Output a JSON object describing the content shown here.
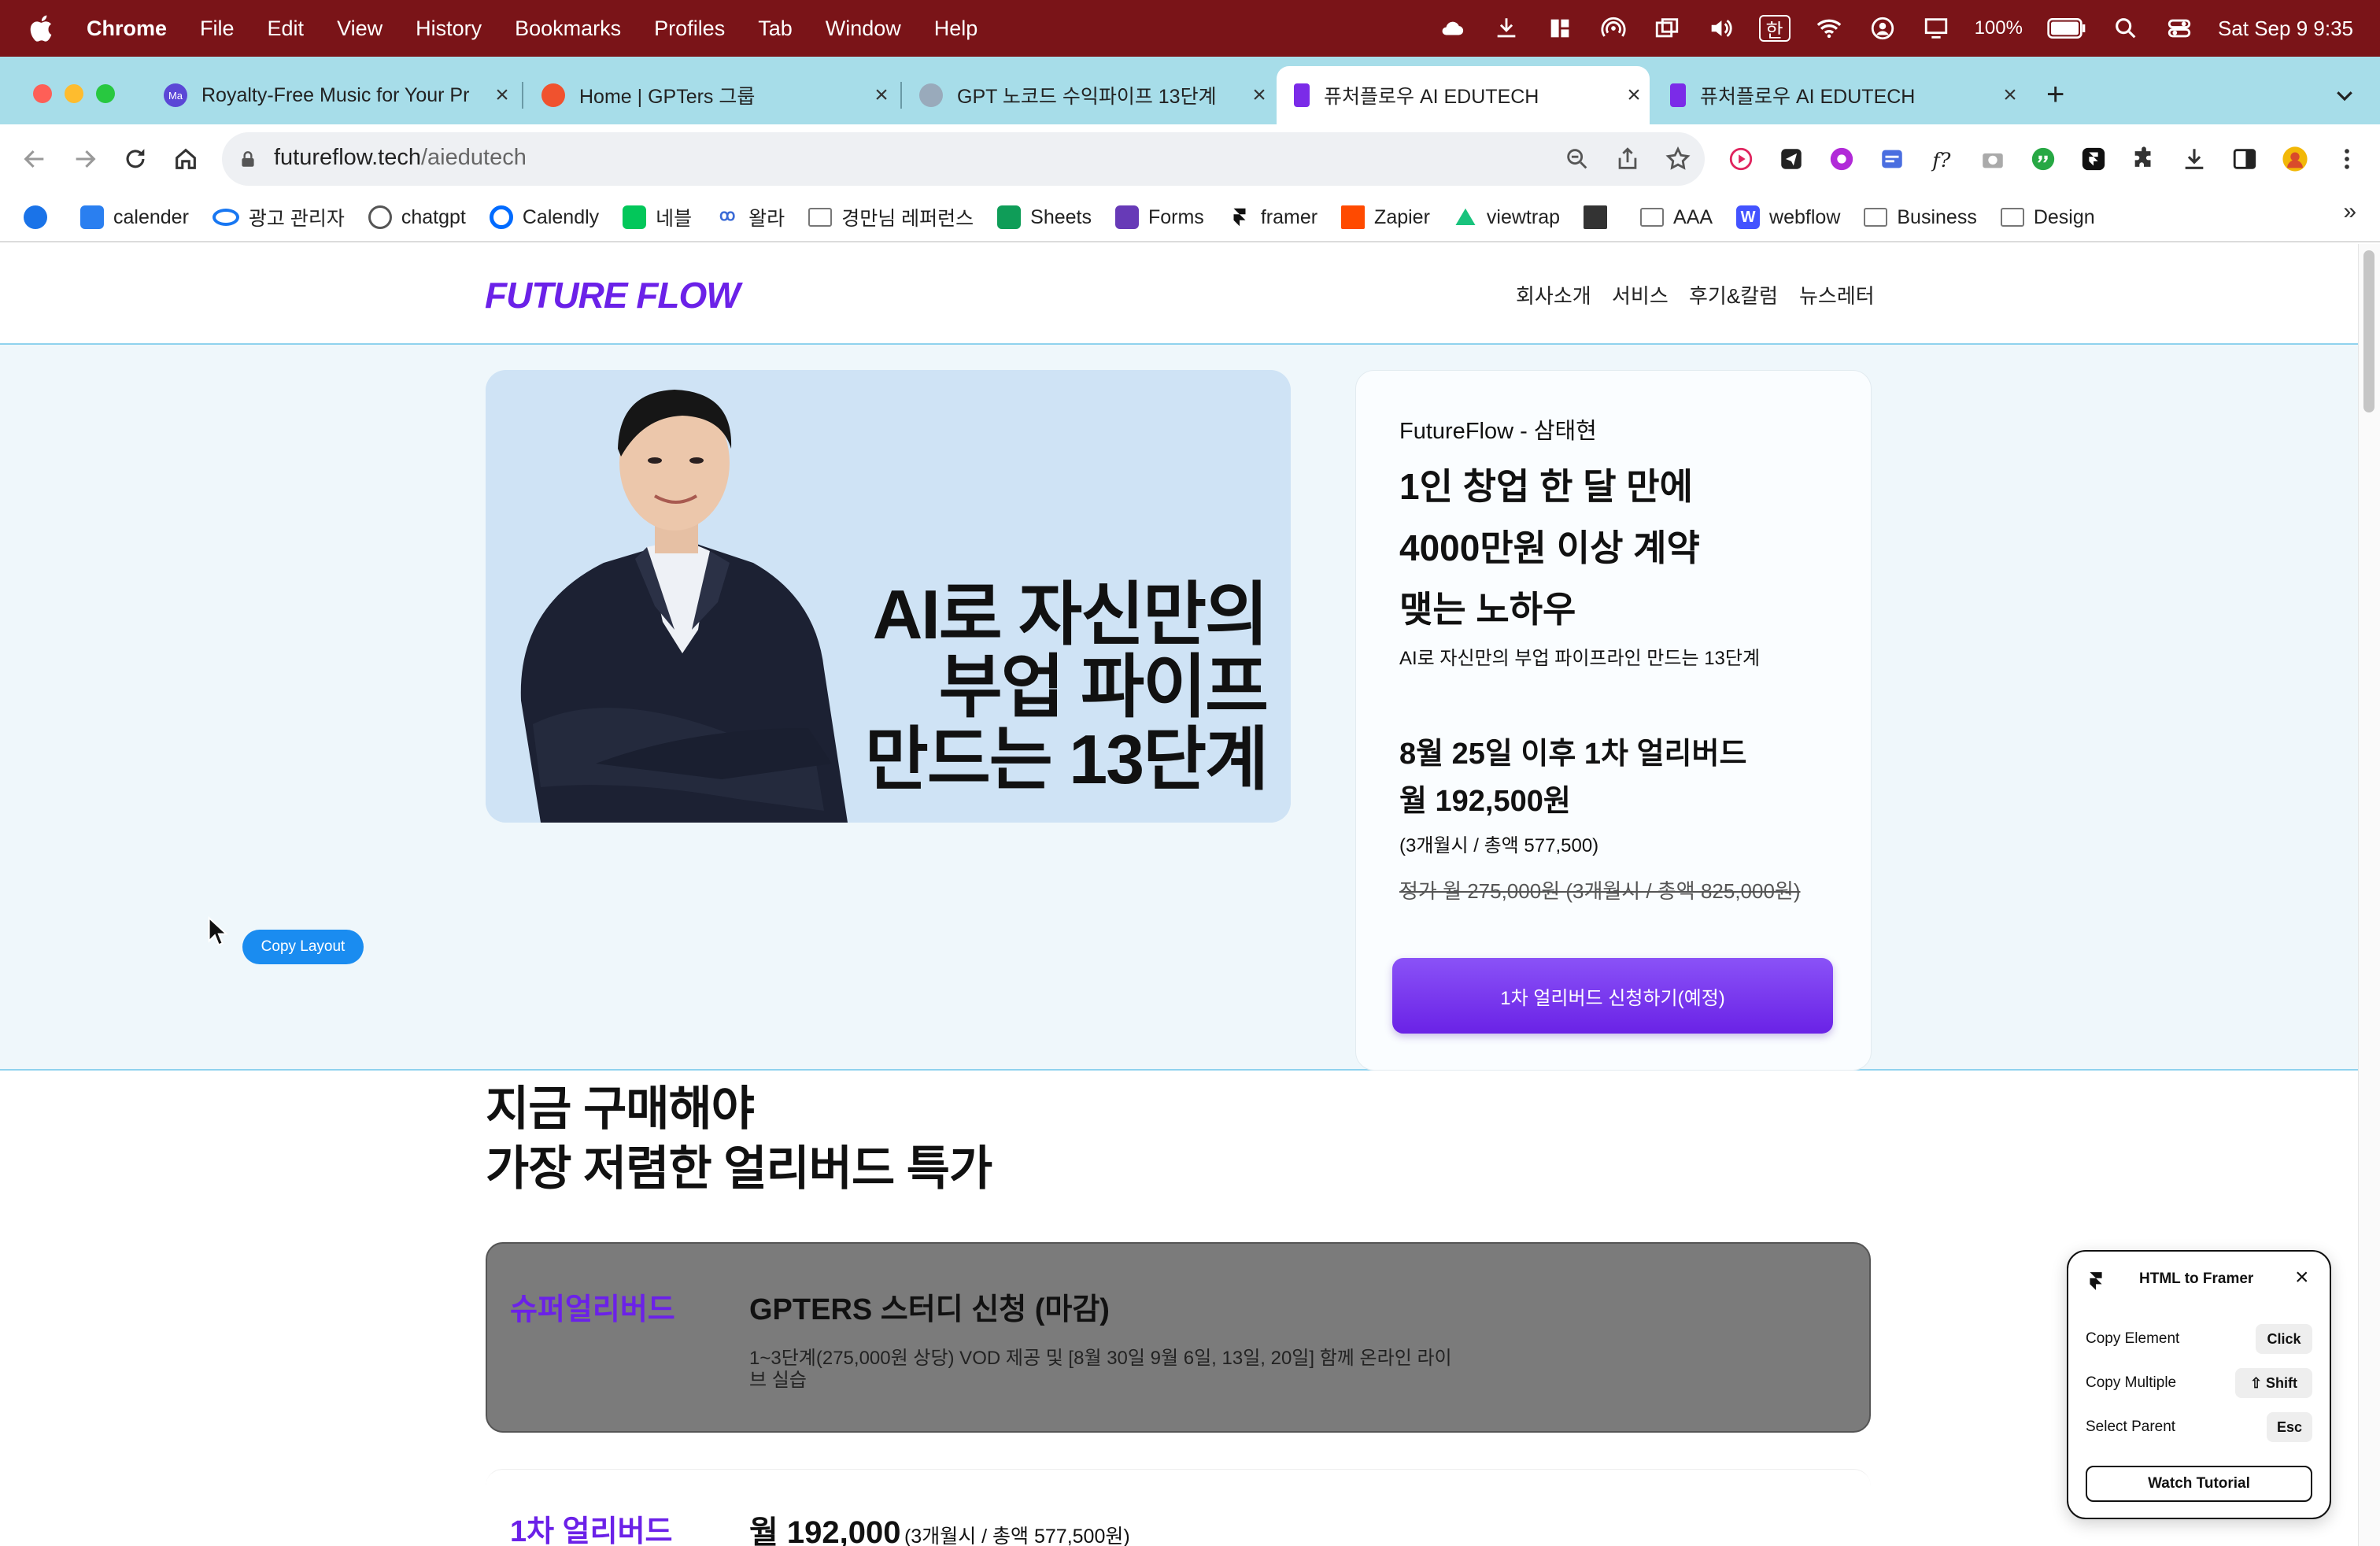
{
  "menubar": {
    "app": "Chrome",
    "items": [
      "File",
      "Edit",
      "View",
      "History",
      "Bookmarks",
      "Profiles",
      "Tab",
      "Window",
      "Help"
    ],
    "battery": "100%",
    "ime": "한",
    "clock": "Sat Sep 9  9:35"
  },
  "tabs": [
    {
      "title": "Royalty-Free Music for Your Pr",
      "favicon_text": "Ma",
      "color": "#5b47d6"
    },
    {
      "title": "Home | GPTers 그룹",
      "color": "#f0522e"
    },
    {
      "title": "GPT 노코드 수익파이프 13단계",
      "color": "#9ab"
    },
    {
      "title": "퓨처플로우 AI EDUTECH",
      "color": "#7b2be8"
    },
    {
      "title": "퓨처플로우 AI EDUTECH",
      "color": "#7b2be8"
    }
  ],
  "toolbar": {
    "url_host": "futureflow.tech",
    "url_path": "/aiedutech"
  },
  "bookmarks": [
    {
      "label": "",
      "color": "#1a73e8"
    },
    {
      "label": "calender",
      "color": "#2a7ff0"
    },
    {
      "label": "광고 관리자",
      "color": "#1877f2"
    },
    {
      "label": "chatgpt",
      "color": "#10a37f"
    },
    {
      "label": "Calendly",
      "color": "#006bff"
    },
    {
      "label": "네블",
      "color": "#03c75a"
    },
    {
      "label": "왈라",
      "color": "#3b6bd6"
    },
    {
      "label": "경만님 레퍼런스",
      "color": "#888"
    },
    {
      "label": "Sheets",
      "color": "#0f9d58"
    },
    {
      "label": "Forms",
      "color": "#673ab7"
    },
    {
      "label": "framer",
      "color": "#111"
    },
    {
      "label": "Zapier",
      "color": "#ff4a00"
    },
    {
      "label": "viewtrap",
      "color": "#19c37d"
    },
    {
      "label": "",
      "color": "#333"
    },
    {
      "label": "AAA",
      "color": "#888"
    },
    {
      "label": "webflow",
      "color": "#4353ff"
    },
    {
      "label": "Business",
      "color": "#888"
    },
    {
      "label": "Design",
      "color": "#888"
    }
  ],
  "site": {
    "logo": "FUTURE FLOW",
    "nav": [
      "회사소개",
      "서비스",
      "후기&칼럼",
      "뉴스레터"
    ]
  },
  "hero": {
    "image_title_lines": [
      "AI로 자신만의",
      "부업 파이프",
      "만드는 13단계"
    ],
    "instructor": "FutureFlow - 삼태현",
    "headline_lines": [
      "1인 창업 한 달 만에",
      "4000만원 이상 계약",
      "맺는 노하우"
    ],
    "subtitle": "AI로 자신만의 부업 파이프라인 만드는 13단계",
    "price_heading": "8월 25일 이후 1차 얼리버드",
    "price": "월 192,500원",
    "price_note": "(3개월시 / 총액 577,500)",
    "regular_price": "정가 월 275,000원 (3개월시 / 총액 825,000원)",
    "cta": "1차 얼리버드 신청하기(예정)"
  },
  "overlay": {
    "copy_layout": "Copy Layout"
  },
  "section": {
    "heading_lines": [
      "지금 구매해야",
      "가장 저렴한 얼리버드 특가"
    ],
    "offers": [
      {
        "tier": "슈퍼얼리버드",
        "title": "GPTERS 스터디 신청 (마감)",
        "desc_lines": [
          "1~3단계(275,000원 상당) VOD 제공 및 [8월 30일 9월 6일, 13일, 20일] 함께 온라인 라이",
          "브 실습"
        ]
      },
      {
        "tier": "1차 얼리버드",
        "price": "월 192,000",
        "price_note": "(3개월시 / 총액 577,500원)"
      }
    ]
  },
  "framer_panel": {
    "title": "HTML to Framer",
    "rows": [
      {
        "label": "Copy Element",
        "key": "Click"
      },
      {
        "label": "Copy Multiple",
        "key": "⇧ Shift"
      },
      {
        "label": "Select Parent",
        "key": "Esc"
      }
    ],
    "button": "Watch Tutorial"
  }
}
